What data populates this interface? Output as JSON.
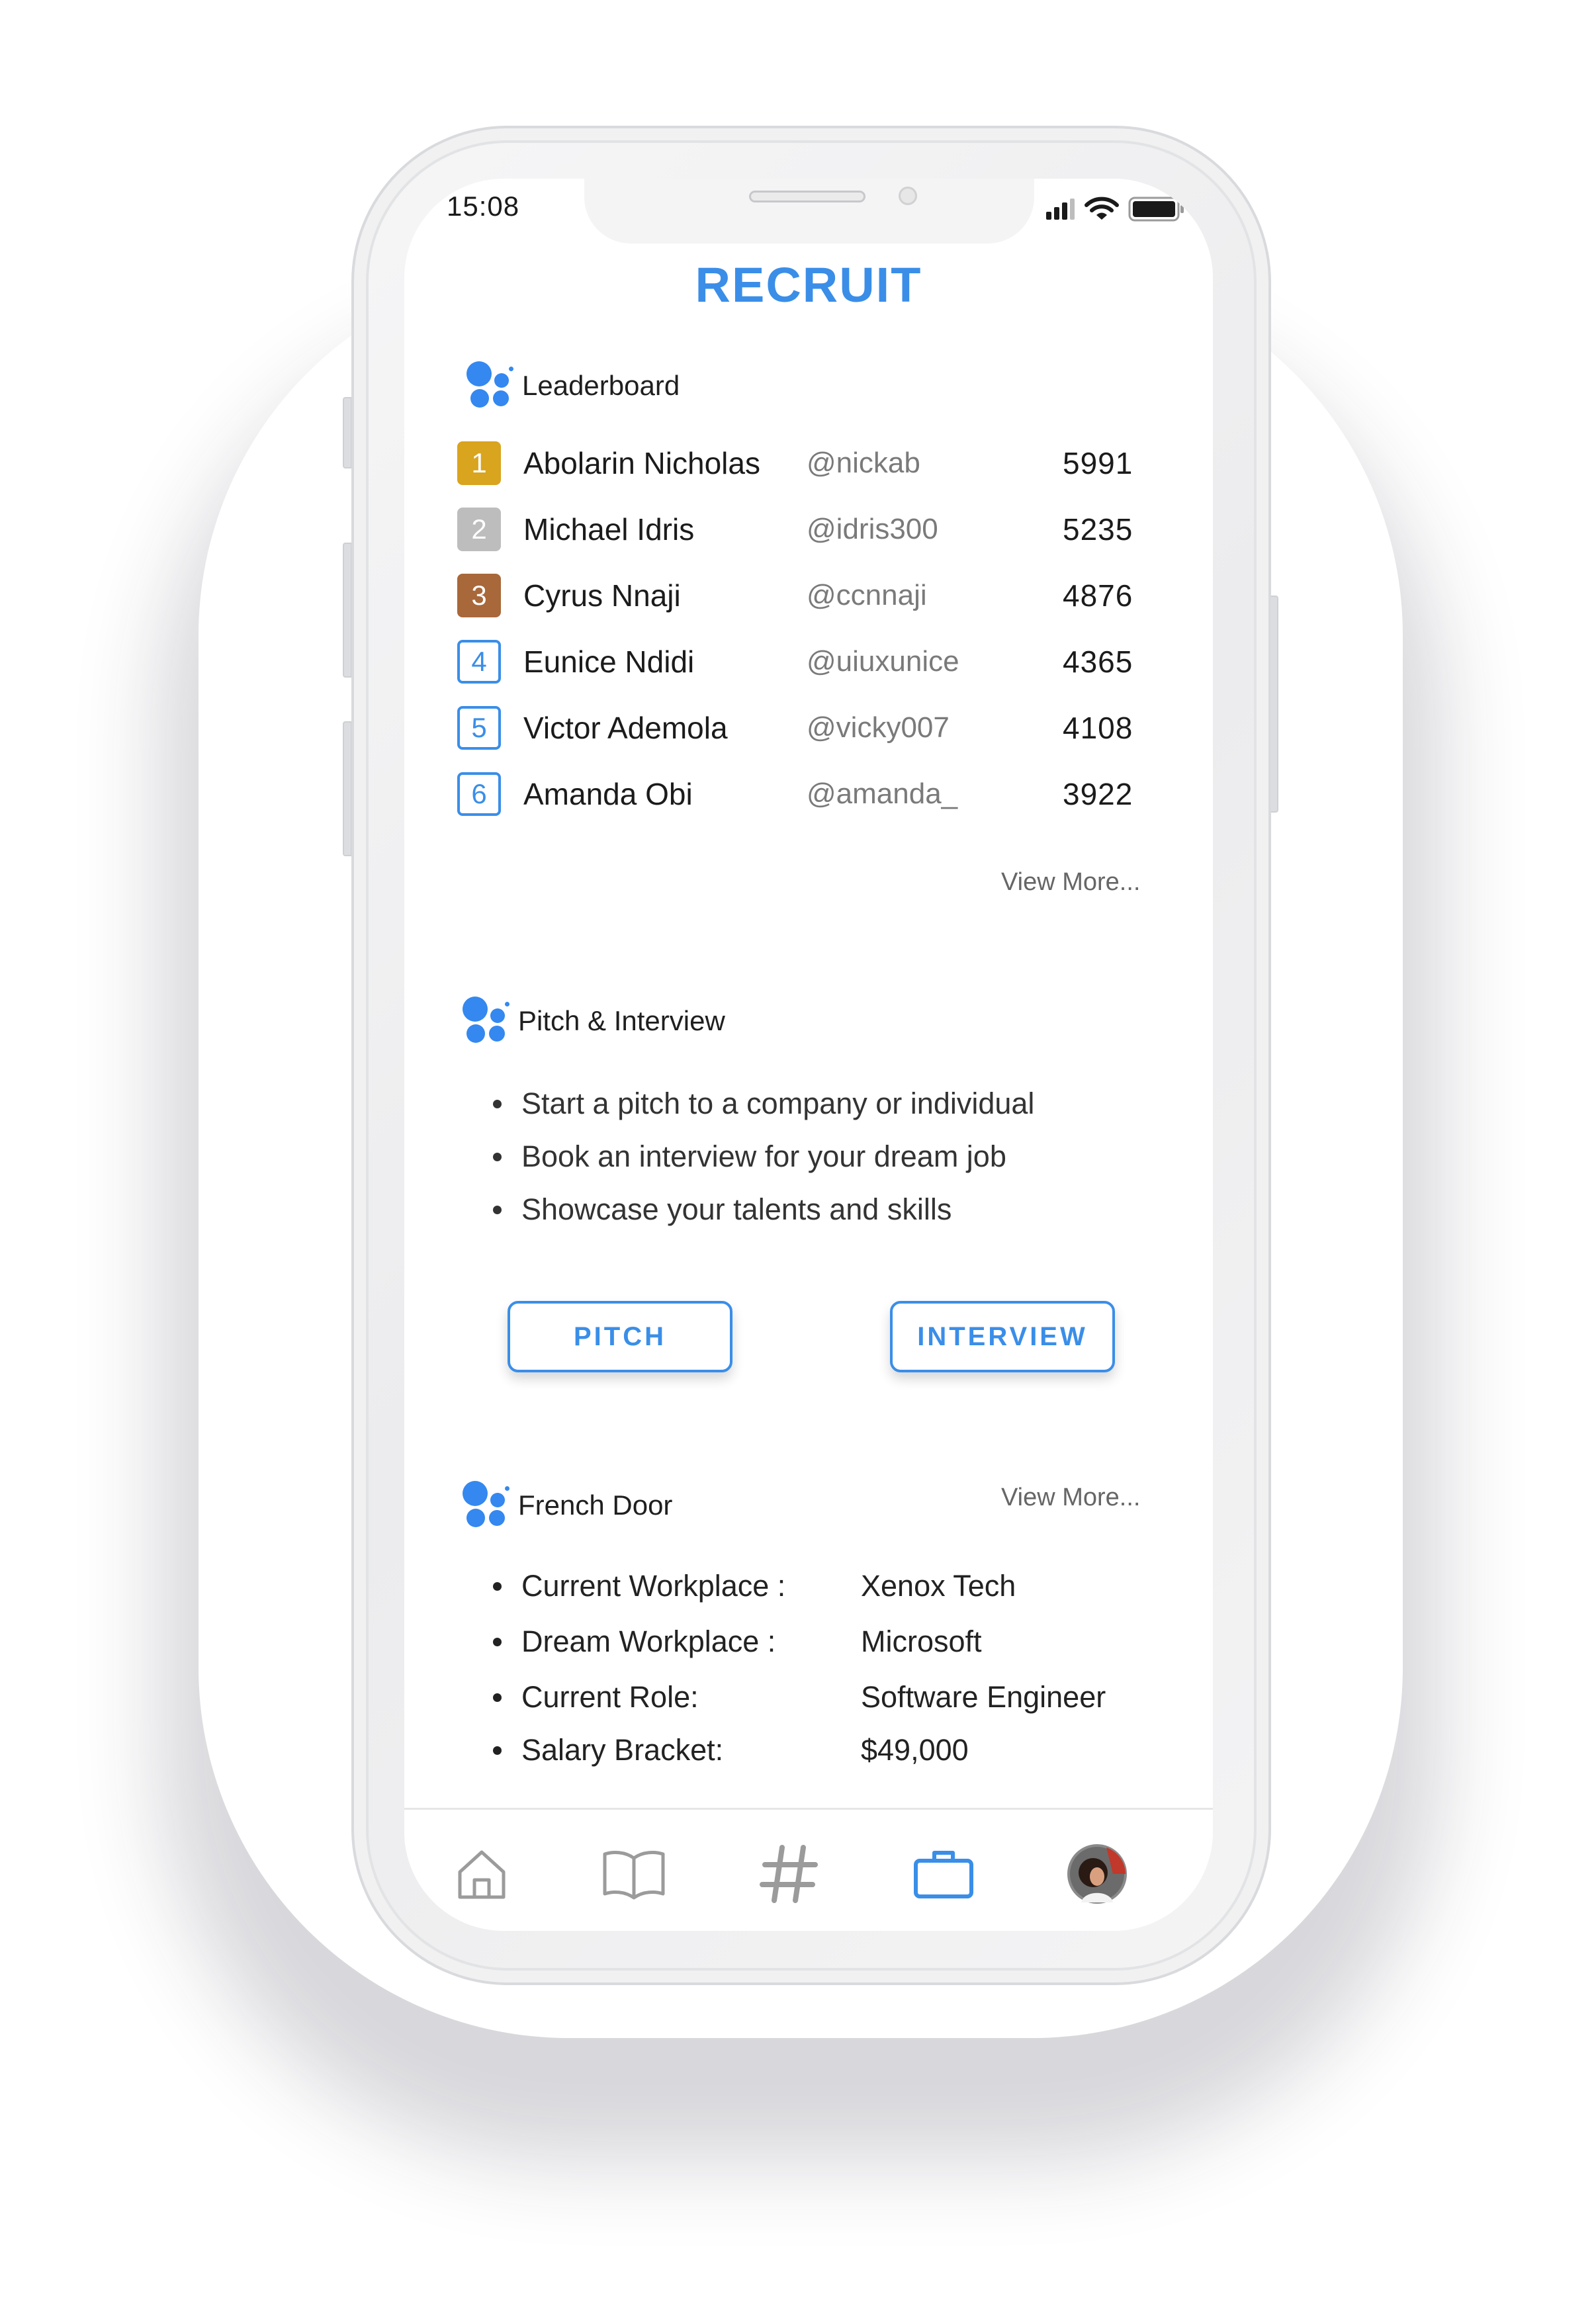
{
  "status_bar": {
    "time": "15:08"
  },
  "header": {
    "title": "RECRUIT"
  },
  "leaderboard": {
    "title": "Leaderboard",
    "rows": [
      {
        "rank": "1",
        "name": "Abolarin Nicholas",
        "handle": "@nickab",
        "score": "5991",
        "badge_color": "#D9A41E",
        "style": "filled"
      },
      {
        "rank": "2",
        "name": "Michael Idris",
        "handle": "@idris300",
        "score": "5235",
        "badge_color": "#BDBDBD",
        "style": "filled"
      },
      {
        "rank": "3",
        "name": "Cyrus Nnaji",
        "handle": "@ccnnaji",
        "score": "4876",
        "badge_color": "#A8683A",
        "style": "filled"
      },
      {
        "rank": "4",
        "name": "Eunice Ndidi",
        "handle": "@uiuxunice",
        "score": "4365",
        "badge_color": "#3A8EE8",
        "style": "outline"
      },
      {
        "rank": "5",
        "name": "Victor Ademola",
        "handle": "@vicky007",
        "score": "4108",
        "badge_color": "#3A8EE8",
        "style": "outline"
      },
      {
        "rank": "6",
        "name": "Amanda Obi",
        "handle": "@amanda_",
        "score": "3922",
        "badge_color": "#3A8EE8",
        "style": "outline"
      }
    ],
    "view_more": "View More..."
  },
  "pitch": {
    "title": "Pitch & Interview",
    "bullets": [
      "Start a pitch to a company or individual",
      "Book an interview for your dream job",
      "Showcase your talents and skills"
    ],
    "pitch_button": "PITCH",
    "interview_button": "INTERVIEW"
  },
  "french_door": {
    "title": "French Door",
    "view_more": "View More...",
    "rows": [
      {
        "label": "Current Workplace :",
        "value": "Xenox Tech"
      },
      {
        "label": "Dream Workplace :",
        "value": "Microsoft"
      },
      {
        "label": "Current Role:",
        "value": "Software Engineer"
      },
      {
        "label": "Salary Bracket:",
        "value": "$49,000"
      }
    ]
  },
  "tabbar": {
    "items": [
      {
        "icon": "home-icon",
        "active": false
      },
      {
        "icon": "book-icon",
        "active": false
      },
      {
        "icon": "hashtag-icon",
        "active": false
      },
      {
        "icon": "briefcase-icon",
        "active": true
      },
      {
        "icon": "avatar",
        "active": false
      }
    ]
  },
  "colors": {
    "accent": "#3A8EE8",
    "dot_blue": "#3488F0",
    "inactive_icon": "#9B9B9B"
  }
}
